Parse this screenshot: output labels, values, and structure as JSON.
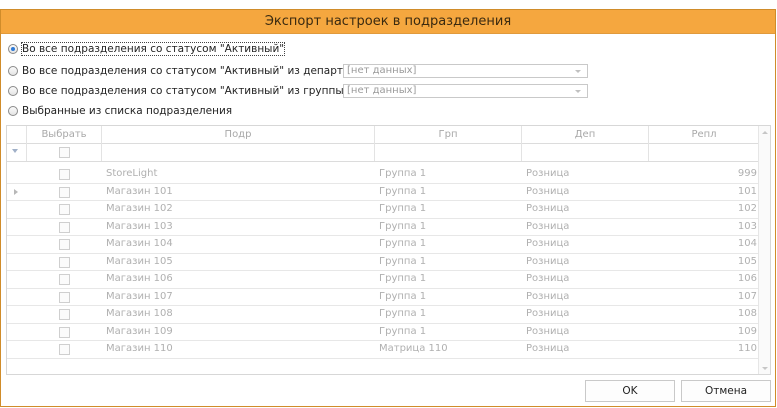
{
  "dialog": {
    "title": "Экспорт настроек в подразделения"
  },
  "options": [
    {
      "label": "Во все подразделения со статусом \"Активный\"",
      "selected": true
    },
    {
      "label": "Во все подразделения со статусом \"Активный\" из департамента",
      "selected": false,
      "combo": "[нет данных]"
    },
    {
      "label": "Во все подразделения со статусом \"Активный\" из группы",
      "selected": false,
      "combo": "[нет данных]"
    },
    {
      "label": "Выбранные из списка подразделения",
      "selected": false
    }
  ],
  "grid": {
    "columns": {
      "select": "Выбрать",
      "pod": "Подр",
      "grp": "Грп",
      "dep": "Деп",
      "repl": "Репл"
    },
    "rows": [
      {
        "pod": "StoreLight",
        "grp": "Группа 1",
        "dep": "Розница",
        "repl": "999"
      },
      {
        "pod": "Магазин 101",
        "grp": "Группа 1",
        "dep": "Розница",
        "repl": "101"
      },
      {
        "pod": "Магазин 102",
        "grp": "Группа 1",
        "dep": "Розница",
        "repl": "102"
      },
      {
        "pod": "Магазин 103",
        "grp": "Группа 1",
        "dep": "Розница",
        "repl": "103"
      },
      {
        "pod": "Магазин 104",
        "grp": "Группа 1",
        "dep": "Розница",
        "repl": "104"
      },
      {
        "pod": "Магазин 105",
        "grp": "Группа 1",
        "dep": "Розница",
        "repl": "105"
      },
      {
        "pod": "Магазин 106",
        "grp": "Группа 1",
        "dep": "Розница",
        "repl": "106"
      },
      {
        "pod": "Магазин 107",
        "grp": "Группа 1",
        "dep": "Розница",
        "repl": "107"
      },
      {
        "pod": "Магазин 108",
        "grp": "Группа 1",
        "dep": "Розница",
        "repl": "108"
      },
      {
        "pod": "Магазин 109",
        "grp": "Группа 1",
        "dep": "Розница",
        "repl": "109"
      },
      {
        "pod": "Магазин 110",
        "grp": "Матрица 110",
        "dep": "Розница",
        "repl": "110"
      }
    ]
  },
  "buttons": {
    "ok": "OK",
    "cancel": "Отмена"
  },
  "colors": {
    "title_bar": "#f5a73f",
    "border": "#d08c2a",
    "radio_dot": "#2f7ad6"
  }
}
